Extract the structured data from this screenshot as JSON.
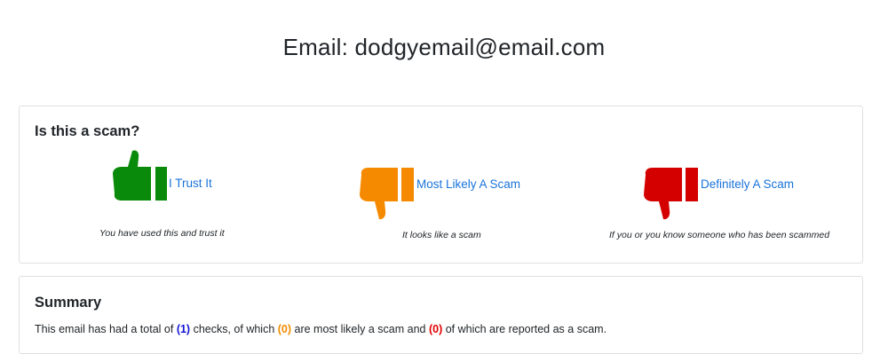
{
  "header": {
    "title": "Email: dodgyemail@email.com"
  },
  "vote": {
    "heading": "Is this a scam?",
    "options": [
      {
        "label": "I Trust It",
        "description": "You have used this and trust it",
        "icon": "thumbs-up-icon",
        "color": "#0a8a0a"
      },
      {
        "label": "Most Likely A Scam",
        "description": "It looks like a scam",
        "icon": "thumbs-down-icon",
        "color": "#f58a00"
      },
      {
        "label": "Definitely A Scam",
        "description": "If you or you know someone who has been scammed",
        "icon": "thumbs-down-icon",
        "color": "#d40000"
      }
    ]
  },
  "summary": {
    "heading": "Summary",
    "text_prefix": "This email has had a total of ",
    "total": "(1)",
    "text_mid1": " checks, of which ",
    "likely": "(0)",
    "text_mid2": " are most likely a scam and ",
    "definite": "(0)",
    "text_suffix": " of which are reported as a scam."
  }
}
